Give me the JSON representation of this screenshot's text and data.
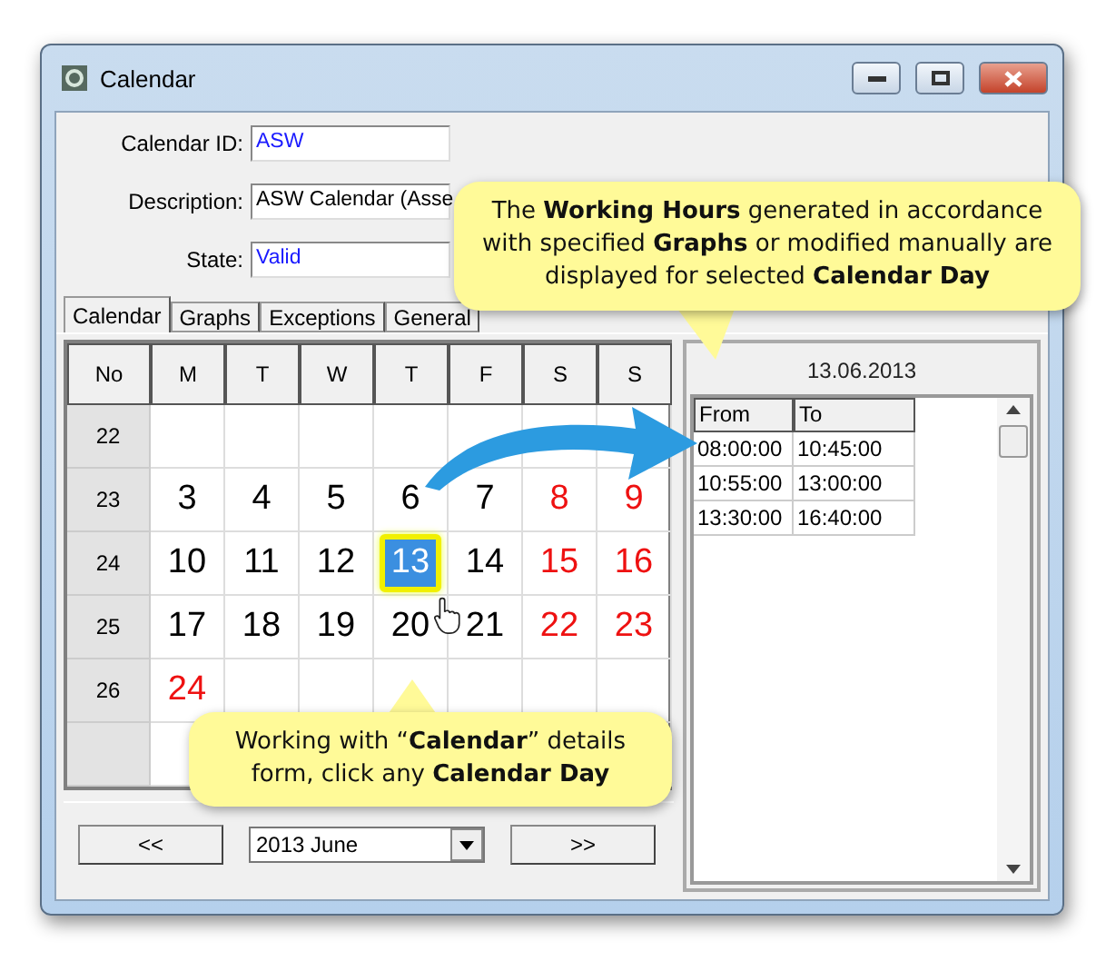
{
  "window": {
    "title": "Calendar"
  },
  "form": [
    {
      "label": "Calendar ID:",
      "value": "ASW",
      "kind": "link"
    },
    {
      "label": "Description:",
      "value": "ASW Calendar (Asse",
      "kind": "plain"
    },
    {
      "label": "State:",
      "value": "Valid",
      "kind": "link"
    }
  ],
  "tabs": [
    {
      "label": "Calendar",
      "selected": true
    },
    {
      "label": "Graphs",
      "selected": false
    },
    {
      "label": "Exceptions",
      "selected": false
    },
    {
      "label": "General",
      "selected": false
    }
  ],
  "calendar": {
    "columns": [
      "No",
      "M",
      "T",
      "W",
      "T",
      "F",
      "S",
      "S"
    ],
    "rows": [
      {
        "week": "22"
      },
      {
        "week": "23",
        "days": [
          {
            "text": "3",
            "kind": "workday",
            "selected": false
          },
          {
            "text": "4",
            "kind": "workday",
            "selected": false
          },
          {
            "text": "5",
            "kind": "workday",
            "selected": false
          },
          {
            "text": "6",
            "kind": "workday",
            "selected": false
          },
          {
            "text": "7",
            "kind": "workday",
            "selected": false
          },
          {
            "text": "8",
            "kind": "holiday",
            "selected": false
          },
          {
            "text": "9",
            "kind": "holiday",
            "selected": false
          }
        ]
      },
      {
        "week": "24",
        "days": [
          {
            "text": "10",
            "kind": "workday",
            "selected": false
          },
          {
            "text": "11",
            "kind": "workday",
            "selected": false
          },
          {
            "text": "12",
            "kind": "workday",
            "selected": false
          },
          {
            "text": "13",
            "kind": "workday",
            "selected": true
          },
          {
            "text": "14",
            "kind": "workday",
            "selected": false
          },
          {
            "text": "15",
            "kind": "holiday",
            "selected": false
          },
          {
            "text": "16",
            "kind": "holiday",
            "selected": false
          }
        ]
      },
      {
        "week": "25",
        "days": [
          {
            "text": "17",
            "kind": "workday",
            "selected": false
          },
          {
            "text": "18",
            "kind": "workday",
            "selected": false
          },
          {
            "text": "19",
            "kind": "workday",
            "selected": false
          },
          {
            "text": "20",
            "kind": "workday",
            "selected": false
          },
          {
            "text": "21",
            "kind": "workday",
            "selected": false
          },
          {
            "text": "22",
            "kind": "holiday",
            "selected": false
          },
          {
            "text": "23",
            "kind": "holiday",
            "selected": false
          }
        ]
      },
      {
        "week": "26",
        "days": [
          {
            "text": "24",
            "kind": "holiday",
            "selected": false
          }
        ]
      }
    ],
    "prev_button": "<<",
    "month": "2013 June",
    "next_button": ">>"
  },
  "hours": {
    "date": "13.06.2013",
    "columns": [
      "From",
      "To"
    ],
    "rows": [
      [
        "08:00:00",
        "10:45:00"
      ],
      [
        "10:55:00",
        "13:00:00"
      ],
      [
        "13:30:00",
        "16:40:00"
      ]
    ]
  },
  "callouts": [
    {
      "text": "The **Working Hours** generated in accordance with specified **Graphs** or modified manually are displayed for selected **Calendar Day**"
    },
    {
      "text": "Working with “**Calendar**” details form, click any **Calendar Day**"
    }
  ]
}
